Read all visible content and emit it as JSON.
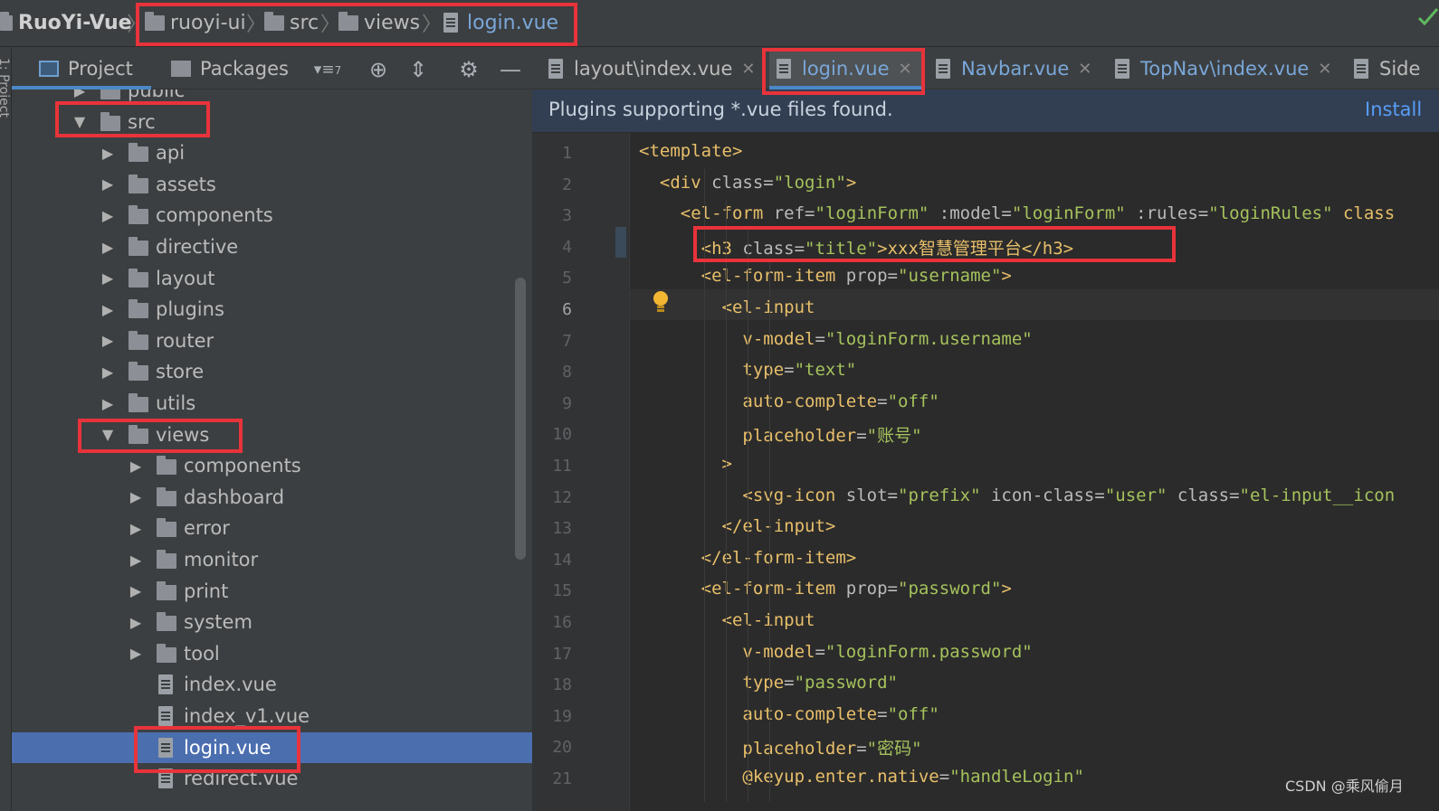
{
  "breadcrumb": {
    "project": "RuoYi-Vue",
    "items": [
      "ruoyi-ui",
      "src",
      "views",
      "login.vue"
    ]
  },
  "left_strip": {
    "label": "1: Project"
  },
  "project_panel": {
    "tabs": [
      "Project",
      "Packages"
    ],
    "sort_badge": "7",
    "icons": [
      "filter-icon",
      "locate-icon",
      "collapse-icon",
      "gear-icon",
      "minimize-icon"
    ]
  },
  "tree": [
    {
      "name": "public",
      "type": "folder",
      "expanded": false
    },
    {
      "name": "src",
      "type": "folder",
      "expanded": true
    },
    {
      "name": "api",
      "type": "folder",
      "expanded": false
    },
    {
      "name": "assets",
      "type": "folder",
      "expanded": false
    },
    {
      "name": "components",
      "type": "folder",
      "expanded": false
    },
    {
      "name": "directive",
      "type": "folder",
      "expanded": false
    },
    {
      "name": "layout",
      "type": "folder",
      "expanded": false
    },
    {
      "name": "plugins",
      "type": "folder",
      "expanded": false
    },
    {
      "name": "router",
      "type": "folder",
      "expanded": false
    },
    {
      "name": "store",
      "type": "folder",
      "expanded": false
    },
    {
      "name": "utils",
      "type": "folder",
      "expanded": false
    },
    {
      "name": "views",
      "type": "folder",
      "expanded": true
    },
    {
      "name": "components",
      "type": "folder",
      "expanded": false
    },
    {
      "name": "dashboard",
      "type": "folder",
      "expanded": false
    },
    {
      "name": "error",
      "type": "folder",
      "expanded": false
    },
    {
      "name": "monitor",
      "type": "folder",
      "expanded": false
    },
    {
      "name": "print",
      "type": "folder",
      "expanded": false
    },
    {
      "name": "system",
      "type": "folder",
      "expanded": false
    },
    {
      "name": "tool",
      "type": "folder",
      "expanded": false
    },
    {
      "name": "index.vue",
      "type": "file"
    },
    {
      "name": "index_v1.vue",
      "type": "file"
    },
    {
      "name": "login.vue",
      "type": "file",
      "selected": true
    },
    {
      "name": "redirect.vue",
      "type": "file"
    }
  ],
  "editor_tabs": [
    {
      "label": "layout\\index.vue",
      "active": false
    },
    {
      "label": "login.vue",
      "active": true
    },
    {
      "label": "Navbar.vue",
      "active": false
    },
    {
      "label": "TopNav\\index.vue",
      "active": false
    },
    {
      "label": "Side",
      "active": false
    }
  ],
  "banner": {
    "message": "Plugins supporting *.vue files found.",
    "action": "Install"
  },
  "code": {
    "current_line": 6,
    "lines": [
      "<template>",
      "  <div class=\"login\">",
      "    <el-form ref=\"loginForm\" :model=\"loginForm\" :rules=\"loginRules\" class",
      "      <h3 class=\"title\">xxx智慧管理平台</h3>",
      "      <el-form-item prop=\"username\">",
      "        <el-input",
      "          v-model=\"loginForm.username\"",
      "          type=\"text\"",
      "          auto-complete=\"off\"",
      "          placeholder=\"账号\"",
      "        >",
      "          <svg-icon slot=\"prefix\" icon-class=\"user\" class=\"el-input__icon",
      "        </el-input>",
      "      </el-form-item>",
      "      <el-form-item prop=\"password\">",
      "        <el-input",
      "          v-model=\"loginForm.password\"",
      "          type=\"password\"",
      "          auto-complete=\"off\"",
      "          placeholder=\"密码\"",
      "          @keyup.enter.native=\"handleLogin\""
    ]
  },
  "watermark": "CSDN @乘风偷月",
  "colors": {
    "tag": "#e8bf6a",
    "attr": "#bababa",
    "string": "#a5c25c",
    "selection": "#4b6eaf",
    "highlight": "#e8333a"
  }
}
